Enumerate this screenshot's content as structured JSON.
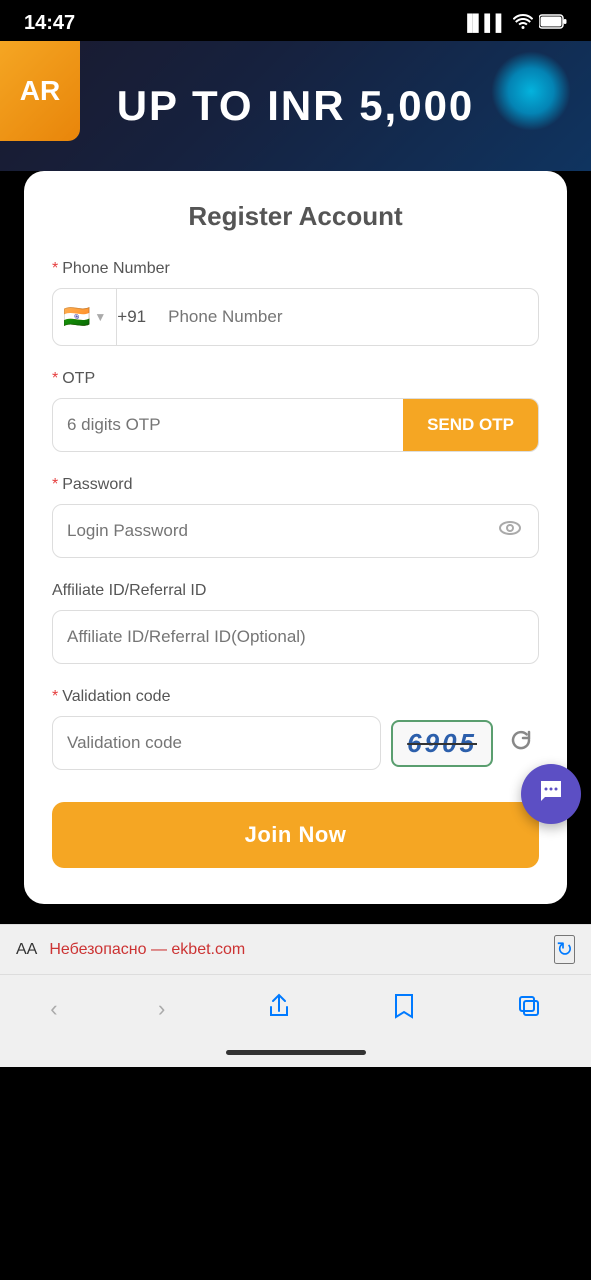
{
  "statusBar": {
    "time": "14:47"
  },
  "banner": {
    "text": "UP TO INR 5,000",
    "arLabel": "AR"
  },
  "form": {
    "title": "Register Account",
    "phoneField": {
      "label": "Phone Number",
      "required": true,
      "countryCode": "+91",
      "flagEmoji": "🇮🇳",
      "placeholder": "Phone Number"
    },
    "otpField": {
      "label": "OTP",
      "required": true,
      "placeholder": "6 digits OTP",
      "sendButtonLabel": "SEND OTP"
    },
    "passwordField": {
      "label": "Password",
      "required": true,
      "placeholder": "Login Password"
    },
    "affiliateField": {
      "label": "Affiliate ID/Referral ID",
      "required": false,
      "placeholder": "Affiliate ID/Referral ID(Optional)"
    },
    "validationField": {
      "label": "Validation code",
      "required": true,
      "placeholder": "Validation code",
      "captchaValue": "6905"
    },
    "joinButton": "Join Now"
  },
  "browserBar": {
    "aaLabel": "AA",
    "url": "Небезопасно — ekbet.com"
  },
  "nav": {
    "back": "‹",
    "forward": "›",
    "share": "↑",
    "bookmarks": "📖",
    "tabs": "⧉"
  }
}
